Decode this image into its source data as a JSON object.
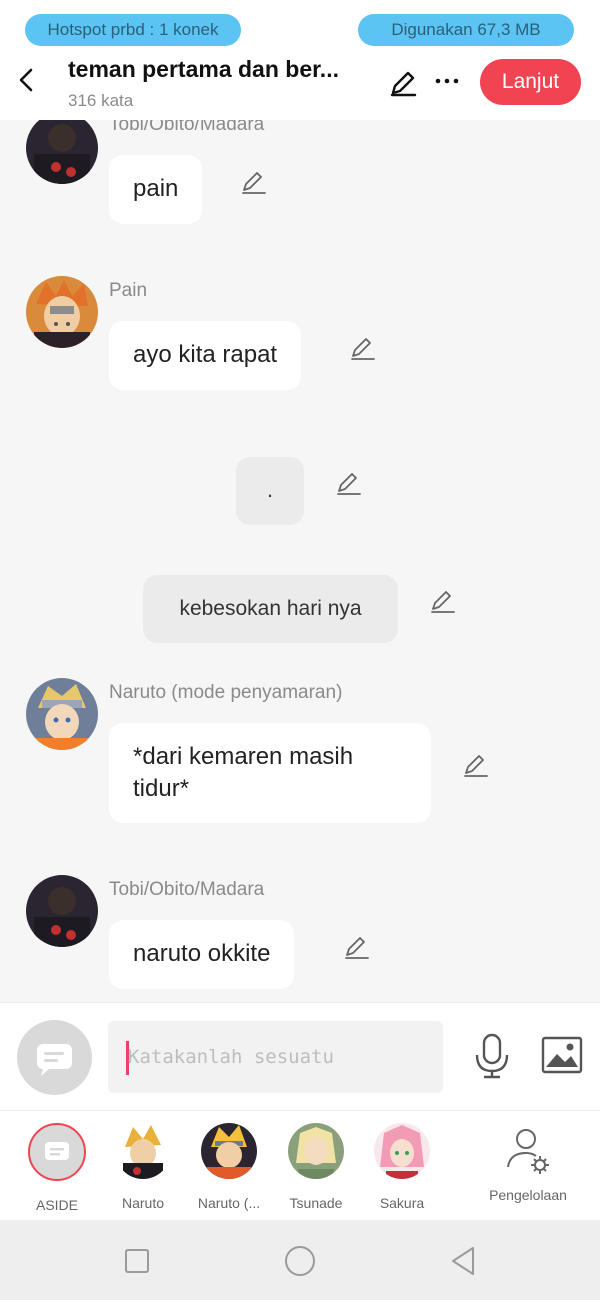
{
  "status": {
    "hotspot": "Hotspot prbd : 1 konek",
    "usage": "Digunakan 67,3 MB"
  },
  "header": {
    "title": "teman pertama dan ber...",
    "word_count": "316 kata",
    "next_label": "Lanjut"
  },
  "messages": [
    {
      "sender": "Tobi/Obito/Madara",
      "text": "pain"
    },
    {
      "sender": "Pain",
      "text": "ayo kita rapat"
    },
    {
      "narration": "."
    },
    {
      "narration": "kebesokan hari nya"
    },
    {
      "sender": "Naruto (mode penyamaran)",
      "text": "*dari kemaren masih tidur*"
    },
    {
      "sender": "Tobi/Obito/Madara",
      "text": "naruto okkite"
    }
  ],
  "input": {
    "placeholder": "Katakanlah sesuatu"
  },
  "characters": [
    {
      "label": "ASIDE"
    },
    {
      "label": "Naruto"
    },
    {
      "label": "Naruto (..."
    },
    {
      "label": "Tsunade"
    },
    {
      "label": "Sakura"
    },
    {
      "label": "Pengelolaan"
    }
  ],
  "colors": {
    "accent": "#f04452",
    "pill": "#5cc4f2",
    "cursor": "#ef3f68"
  },
  "icons": [
    "back-arrow-icon",
    "pencil-icon",
    "more-icon",
    "mic-icon",
    "image-icon",
    "chat-bubble-icon",
    "person-settings-icon",
    "square-nav-icon",
    "circle-nav-icon",
    "triangle-nav-icon"
  ]
}
